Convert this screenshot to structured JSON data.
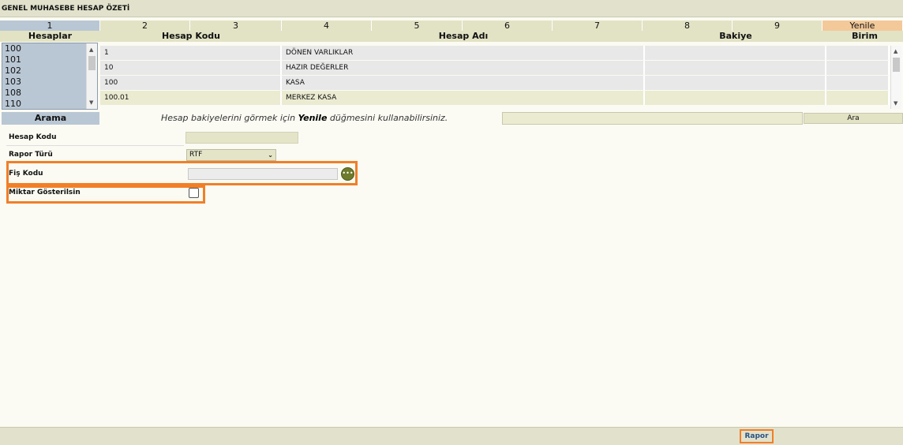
{
  "title": "GENEL MUHASEBE HESAP ÖZETİ",
  "tabs": [
    "1",
    "2",
    "3",
    "4",
    "5",
    "6",
    "7",
    "8",
    "9",
    "Yenile"
  ],
  "headers": {
    "hesaplar": "Hesaplar",
    "hesap_kodu": "Hesap Kodu",
    "hesap_adi": "Hesap Adı",
    "bakiye": "Bakiye",
    "birim": "Birim"
  },
  "account_list": [
    "100",
    "101",
    "102",
    "103",
    "108",
    "110"
  ],
  "rows": [
    {
      "kod": "1",
      "ad": "DÖNEN VARLIKLAR",
      "bakiye": "",
      "birim": ""
    },
    {
      "kod": "10",
      "ad": "HAZIR DEĞERLER",
      "bakiye": "",
      "birim": ""
    },
    {
      "kod": "100",
      "ad": "KASA",
      "bakiye": "",
      "birim": ""
    },
    {
      "kod": "100.01",
      "ad": "MERKEZ KASA",
      "bakiye": "",
      "birim": ""
    }
  ],
  "search": {
    "button": "Arama",
    "hint_before": "Hesap bakiyelerini görmek için ",
    "hint_bold": "Yenile",
    "hint_after": " düğmesini kullanabilirsiniz.",
    "input_value": "",
    "go_button": "Ara"
  },
  "form": {
    "hesap_kodu_label": "Hesap Kodu",
    "hesap_kodu_value": "",
    "rapor_turu_label": "Rapor Türü",
    "rapor_turu_value": "RTF",
    "fis_kodu_label": "Fiş Kodu",
    "fis_kodu_value": "",
    "miktar_label": "Miktar Gösterilsin",
    "miktar_checked": false
  },
  "footer": {
    "rapor_button": "Rapor"
  },
  "colors": {
    "highlight": "#f07f27",
    "active_tab": "#b9c7d5",
    "refresh_tab": "#f3c99a"
  }
}
